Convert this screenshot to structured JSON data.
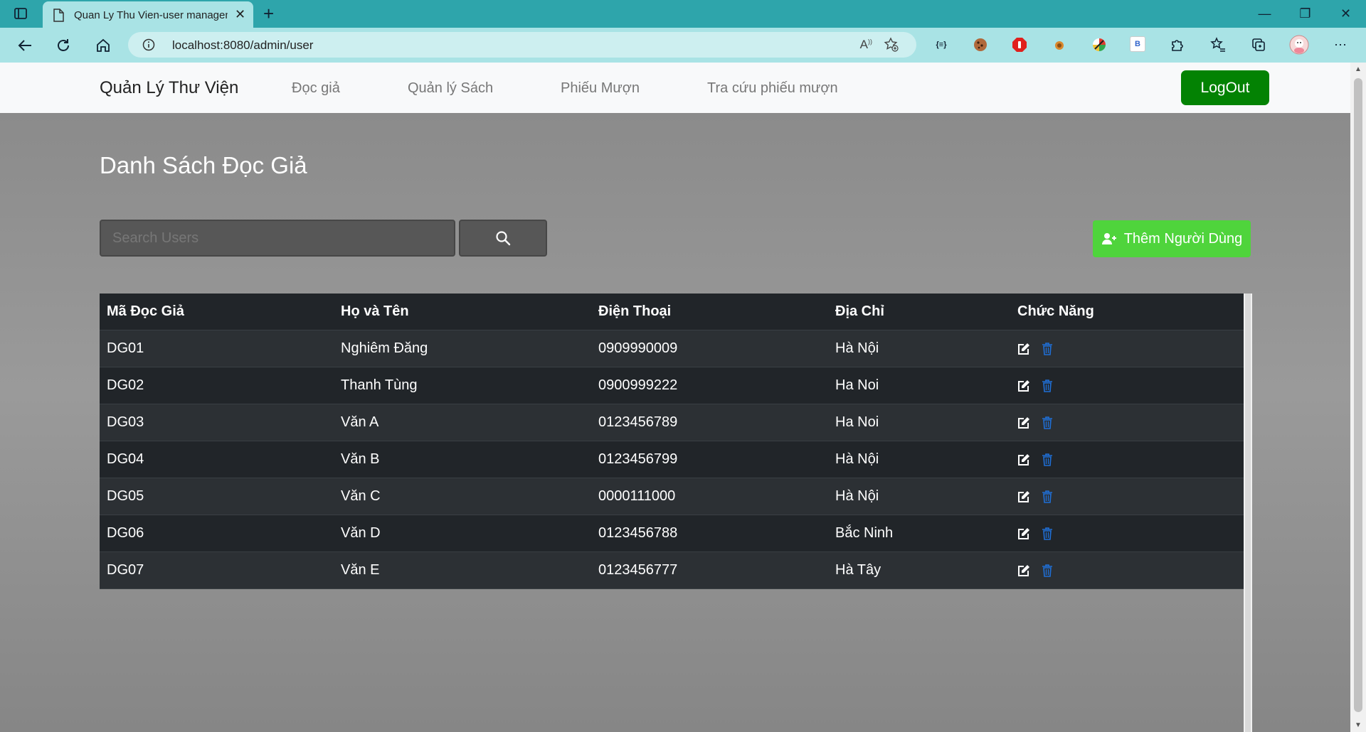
{
  "browser": {
    "tab_title": "Quan Ly Thu Vien-user managem",
    "url": "localhost:8080/admin/user",
    "extensions": [
      "braces-icon",
      "cookie-icon",
      "adblock-icon",
      "fox-icon",
      "wheel-icon",
      "b-extension-icon",
      "puzzle-icon"
    ],
    "ext_b_label": "B",
    "ext_braces_label": "{≡}"
  },
  "nav": {
    "brand": "Quản Lý Thư Viện",
    "items": [
      "Đọc giả",
      "Quản lý Sách",
      "Phiếu Mượn",
      "Tra cứu phiếu mượn"
    ],
    "logout": "LogOut"
  },
  "main": {
    "title": "Danh Sách Đọc Giả",
    "search_placeholder": "Search Users",
    "add_button": "Thêm Người Dùng"
  },
  "table": {
    "headers": [
      "Mã Đọc Giả",
      "Họ và Tên",
      "Điện Thoại",
      "Địa Chỉ",
      "Chức Năng"
    ],
    "rows": [
      [
        "DG01",
        "Nghiêm Đăng",
        "0909990009",
        "Hà Nội"
      ],
      [
        "DG02",
        "Thanh Tùng",
        "0900999222",
        "Ha Noi"
      ],
      [
        "DG03",
        "Văn A",
        "0123456789",
        "Ha Noi"
      ],
      [
        "DG04",
        "Văn B",
        "0123456799",
        "Hà Nội"
      ],
      [
        "DG05",
        "Văn C",
        "0000111000",
        "Hà Nội"
      ],
      [
        "DG06",
        "Văn D",
        "0123456788",
        "Bắc Ninh"
      ],
      [
        "DG07",
        "Văn E",
        "0123456777",
        "Hà Tây"
      ]
    ]
  },
  "colors": {
    "titlebar": "#2ea5ab",
    "logout": "#038203",
    "add_button": "#4fd43c",
    "delete_icon": "#1f6fd6"
  }
}
